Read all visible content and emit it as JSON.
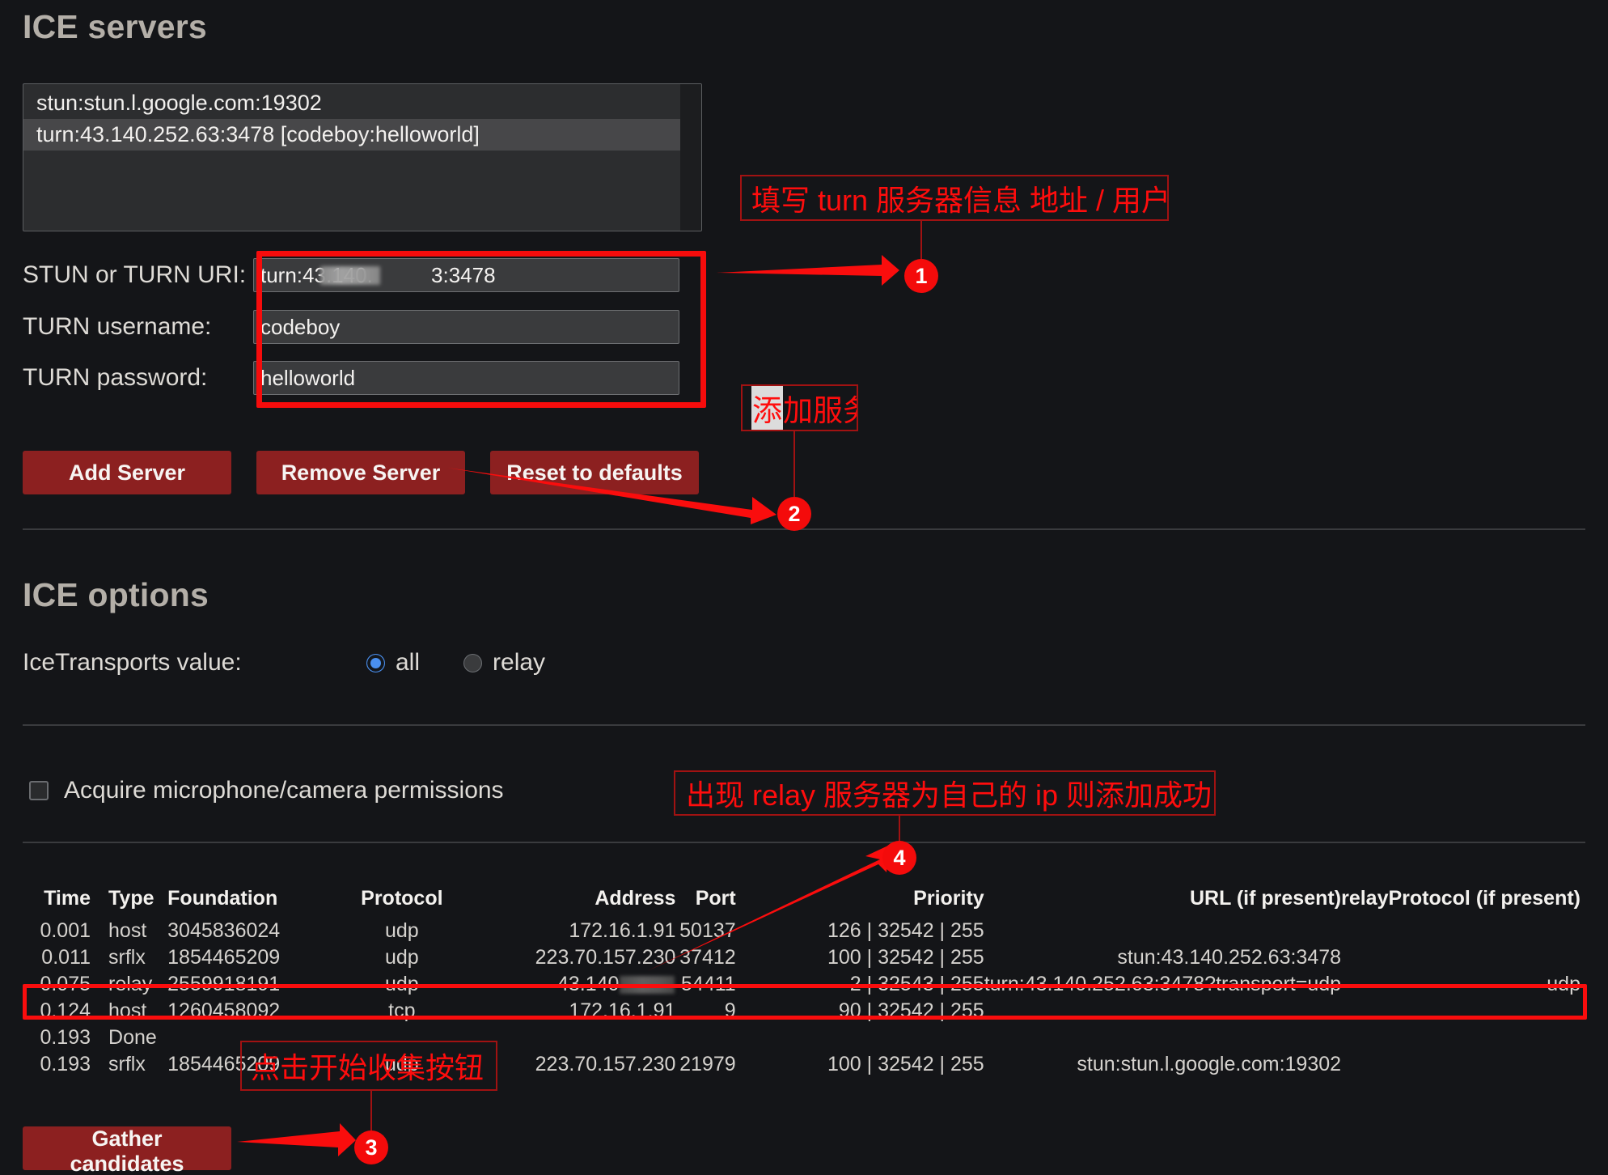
{
  "headings": {
    "ice_servers": "ICE servers",
    "ice_options": "ICE options"
  },
  "server_list": {
    "items": [
      {
        "text": "stun:stun.l.google.com:19302",
        "selected": false
      },
      {
        "text": "turn:43.140.252.63:3478 [codeboy:helloworld]",
        "selected": true
      }
    ]
  },
  "form": {
    "uri": {
      "label": "STUN or TURN URI:",
      "value": "turn:43.140.          3:3478"
    },
    "username": {
      "label": "TURN username:",
      "value": "codeboy"
    },
    "password": {
      "label": "TURN password:",
      "value": "helloworld"
    }
  },
  "buttons": {
    "add_server": "Add Server",
    "remove_server": "Remove Server",
    "reset_defaults": "Reset to defaults",
    "gather_candidates": "Gather candidates"
  },
  "ice_options": {
    "transports_label": "IceTransports value:",
    "options": [
      {
        "label": "all",
        "checked": true
      },
      {
        "label": "relay",
        "checked": false
      }
    ],
    "permissions_label": "Acquire microphone/camera permissions",
    "permissions_checked": false
  },
  "candidates_table": {
    "headers": {
      "time": "Time",
      "type": "Type",
      "foundation": "Foundation",
      "protocol": "Protocol",
      "address": "Address",
      "port": "Port",
      "priority": "Priority",
      "url": "URL (if present)",
      "relay_protocol": "relayProtocol (if present)"
    },
    "rows": [
      {
        "time": "0.001",
        "type": "host",
        "foundation": "3045836024",
        "protocol": "udp",
        "address": "172.16.1.91",
        "port": "50137",
        "priority": "126 | 32542 | 255",
        "url": "",
        "relay_protocol": "",
        "redacted": false,
        "highlighted": false
      },
      {
        "time": "0.011",
        "type": "srflx",
        "foundation": "1854465209",
        "protocol": "udp",
        "address": "223.70.157.230",
        "port": "37412",
        "priority": "100 | 32542 | 255",
        "url": "stun:43.140.252.63:3478",
        "relay_protocol": "",
        "redacted": false,
        "highlighted": false
      },
      {
        "time": "0.075",
        "type": "relay",
        "foundation": "2559918191",
        "protocol": "udp",
        "address": "43.140",
        "port": "54411",
        "priority": "2 | 32543 | 255",
        "url": "turn:43.140.252.63:3478?transport=udp",
        "relay_protocol": "udp",
        "redacted": true,
        "highlighted": true
      },
      {
        "time": "0.124",
        "type": "host",
        "foundation": "1260458092",
        "protocol": "tcp",
        "address": "172.16.1.91",
        "port": "9",
        "priority": "90 | 32542 | 255",
        "url": "",
        "relay_protocol": "",
        "redacted": false,
        "highlighted": false
      },
      {
        "time": "0.193",
        "type": "Done",
        "foundation": "",
        "protocol": "",
        "address": "",
        "port": "",
        "priority": "",
        "url": "",
        "relay_protocol": "",
        "redacted": false,
        "highlighted": false
      },
      {
        "time": "0.193",
        "type": "srflx",
        "foundation": "1854465209",
        "protocol": "udp",
        "address": "223.70.157.230",
        "port": "21979",
        "priority": "100 | 32542 | 255",
        "url": "stun:stun.l.google.com:19302",
        "relay_protocol": "",
        "redacted": false,
        "highlighted": false
      }
    ]
  },
  "annotations": {
    "colors": {
      "marker": "#f40b0b",
      "box_border": "#a11212",
      "text": "#ff0d0d"
    },
    "callout_1": {
      "number": "1",
      "text": "填写 turn 服务器信息 地址 / 用户名 / 密码"
    },
    "callout_2": {
      "number": "2",
      "text_highlight": "添",
      "text_rest": "加服务"
    },
    "callout_3": {
      "number": "3",
      "text": "点击开始收集按钮"
    },
    "callout_4": {
      "number": "4",
      "text": "出现 relay 服务器为自己的 ip 则添加成功"
    }
  }
}
